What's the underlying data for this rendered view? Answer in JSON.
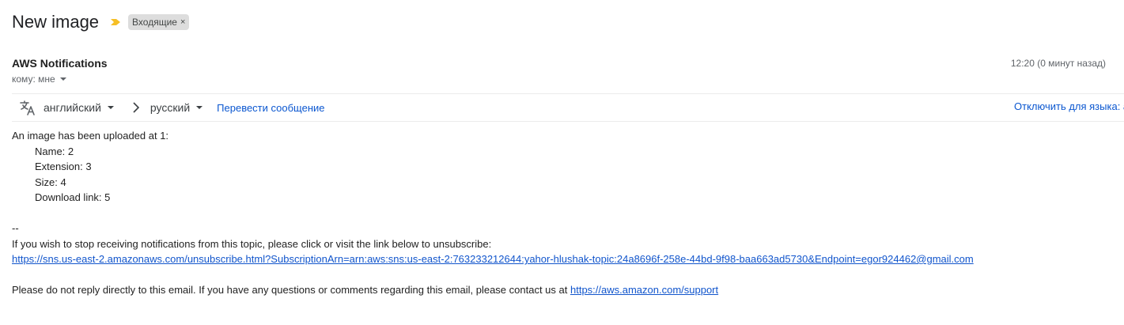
{
  "email": {
    "subject": "New image",
    "label": "Входящие",
    "label_remove": "×",
    "sender": "AWS Notifications",
    "recipient": "кому: мне",
    "timestamp": "12:20 (0 минут назад)"
  },
  "translate_bar": {
    "source_language": "английский",
    "target_language": "русский",
    "translate_label": "Перевести сообщение",
    "disable_label": "Отключить для языка: а"
  },
  "body": {
    "intro": "An image has been uploaded at 1:",
    "fields": [
      "Name: 2",
      "Extension: 3",
      "Size: 4",
      "Download link: 5"
    ],
    "separator": "--",
    "unsubscribe_text": "If you wish to stop receiving notifications from this topic, please click or visit the link below to unsubscribe:",
    "unsubscribe_link": "https://sns.us-east-2.amazonaws.com/unsubscribe.html?SubscriptionArn=arn:aws:sns:us-east-2:763233212644:yahor-hlushak-topic:24a8696f-258e-44bd-9f98-baa663ad5730&Endpoint=egor924462@gmail.com",
    "footer_text": "Please do not reply directly to this email. If you have any questions or comments regarding this email, please contact us at ",
    "support_link": "https://aws.amazon.com/support"
  },
  "colors": {
    "importance_marker": "#f6bf26",
    "link": "#1155cc",
    "ui_link": "#0b57d0",
    "label_chip": "#dddddd"
  },
  "icons": {
    "importance": "importance-marker-icon",
    "translate": "translate-icon",
    "arrow": "chevron-right-icon"
  }
}
